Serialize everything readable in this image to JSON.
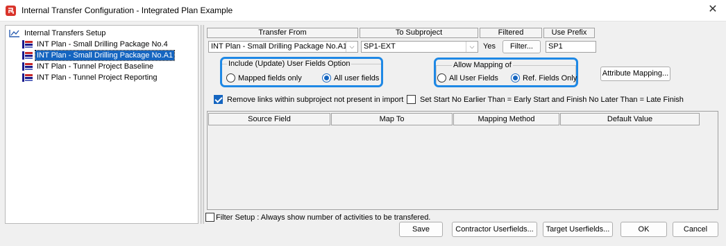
{
  "window": {
    "title": "Internal Transfer Configuration - Integrated Plan Example",
    "close_glyph": "✕",
    "app_icon": "app-logo-icon"
  },
  "tree": {
    "root_label": "Internal Transfers Setup",
    "items": [
      {
        "label": "INT Plan - Small Drilling Package No.4",
        "selected": false
      },
      {
        "label": "INT Plan - Small Drilling Package No.A1",
        "selected": true
      },
      {
        "label": "INT Plan - Tunnel Project Baseline",
        "selected": false
      },
      {
        "label": "INT Plan - Tunnel Project Reporting",
        "selected": false
      }
    ]
  },
  "transfer_header": {
    "transfer_from": "Transfer From",
    "to_subproject": "To Subproject",
    "filtered": "Filtered",
    "use_prefix": "Use Prefix"
  },
  "transfer_row": {
    "transfer_from_value": "INT Plan - Small Drilling Package No.A1",
    "to_subproject_value": "SP1-EXT",
    "filtered_value": "Yes",
    "filter_button": "Filter...",
    "prefix_value": "SP1"
  },
  "user_fields_option": {
    "legend": "Include (Update) User Fields Option",
    "options": [
      "Mapped fields only",
      "All user fields"
    ],
    "selected": "All user fields"
  },
  "allow_mapping": {
    "legend": "Allow Mapping of",
    "options": [
      "All User Fields",
      "Ref. Fields Only"
    ],
    "selected": "Ref. Fields Only"
  },
  "attribute_mapping_button": "Attribute Mapping...",
  "checkboxes": {
    "remove_links": {
      "label": "Remove links within subproject not present in import",
      "checked": true
    },
    "set_start": {
      "label": "Set Start No Earlier Than = Early Start and Finish No Later Than = Late Finish",
      "checked": false
    },
    "filter_setup": {
      "label": "Filter Setup : Always show number of activities to be transfered.",
      "checked": false
    }
  },
  "mapping_grid": {
    "columns": [
      "Source Field",
      "Map To",
      "Mapping Method",
      "Default Value"
    ],
    "rows": []
  },
  "footer_buttons": {
    "save": "Save",
    "contractor_userfields": "Contractor Userfields...",
    "target_userfields": "Target Userfields...",
    "ok": "OK",
    "cancel": "Cancel"
  },
  "colors": {
    "highlight": "#1e88e5",
    "selection": "#1565c0",
    "app_icon": "#d9342b"
  }
}
